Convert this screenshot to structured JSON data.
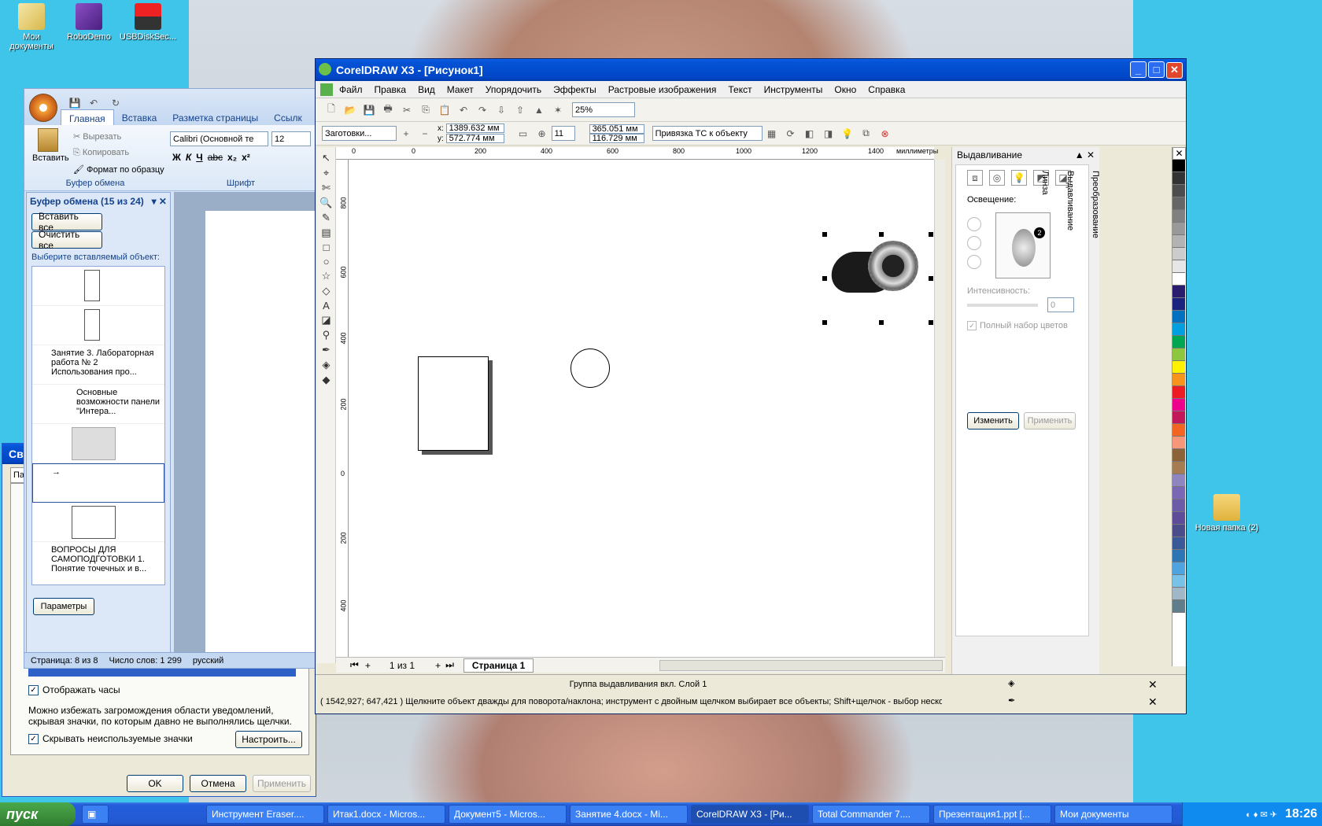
{
  "desktop": {
    "icons_left": [
      {
        "label": "Мои документы",
        "icon": "my-documents-icon"
      },
      {
        "label": "RoboDemo",
        "icon": "robodemo-icon"
      },
      {
        "label": "USBDiskSec...",
        "icon": "usb-disk-icon"
      }
    ],
    "icon_right": {
      "label": "Новая папка (2)",
      "icon": "folder-icon"
    }
  },
  "word": {
    "tabs": [
      "Главная",
      "Вставка",
      "Разметка страницы",
      "Ссылк"
    ],
    "paste_label": "Вставить",
    "cut_label": "Вырезать",
    "copy_label": "Копировать",
    "format_label": "Формат по образцу",
    "group_clipboard": "Буфер обмена",
    "font_name": "Calibri (Основной те",
    "font_size": "12",
    "group_font": "Шрифт",
    "format_buttons": [
      "Ж",
      "К",
      "Ч",
      "abc",
      "x₂",
      "x²"
    ],
    "clipboard_pane": {
      "title": "Буфер обмена (15 из 24)",
      "paste_all": "Вставить все",
      "clear_all": "Очистить все",
      "prompt": "Выберите вставляемый объект:",
      "items": [
        {
          "text": ""
        },
        {
          "text": ""
        },
        {
          "text": "Занятие 3. Лабораторная работа № 2 Использования про..."
        },
        {
          "text": "Основные возможности панели \"Интера..."
        },
        {
          "text": ""
        },
        {
          "text": "→"
        },
        {
          "text": ""
        },
        {
          "text": "ВОПРОСЫ ДЛЯ САМОПОДГОТОВКИ 1. Понятие точечных и в..."
        }
      ],
      "params": "Параметры"
    },
    "status": {
      "page": "Страница: 8 из 8",
      "words": "Число слов: 1 299",
      "lang": "русский"
    }
  },
  "props_dialog": {
    "title": "Сво",
    "tab": "Па",
    "show_clock": "Отображать часы",
    "desc": "Можно избежать загромождения области уведомлений, скрывая значки, по которым давно не выполнялись щелчки.",
    "hide_icons": "Скрывать неиспользуемые значки",
    "customize": "Настроить...",
    "ok": "OK",
    "cancel": "Отмена",
    "apply": "Применить"
  },
  "corel": {
    "title": "CorelDRAW X3 - [Рисунок1]",
    "menu": [
      "Файл",
      "Правка",
      "Вид",
      "Макет",
      "Упорядочить",
      "Эффекты",
      "Растровые изображения",
      "Текст",
      "Инструменты",
      "Окно",
      "Справка"
    ],
    "zoom": "25%",
    "presets": "Заготовки...",
    "x_label": "x:",
    "x_value": "1389.632 мм",
    "y_label": "y:",
    "y_value": "572.774 мм",
    "size_w": "365.051 мм",
    "size_h": "116.729 мм",
    "nudge": "11",
    "snap": "Привязка ТС к объекту",
    "ruler_h_ticks": [
      "0",
      "0",
      "200",
      "400",
      "600",
      "800",
      "1000",
      "1200",
      "1400"
    ],
    "ruler_h_unit": "миллиметры",
    "ruler_v_ticks": [
      "800",
      "600",
      "400",
      "200",
      "0",
      "200",
      "400"
    ],
    "ruler_v_unit": "миллиметры",
    "page_nav": "1 из 1",
    "page_tab": "Страница 1",
    "status_object": "Группа выдавливания вкл. Слой 1",
    "status_hint": "( 1542,927; 647,421 )  Щелкните объект дважды для поворота/наклона; инструмент с двойным щелчком выбирает все объекты; Shift+щелчок - выбор нескол...",
    "docker": {
      "title": "Выдавливание",
      "lighting": "Освещение:",
      "intensity": "Интенсивность:",
      "intensity_value": "0",
      "full_colors": "Полный набор цветов",
      "edit": "Изменить",
      "apply": "Применить",
      "vtabs": [
        "Преобразование",
        "Выдавливание",
        "Линза"
      ],
      "light_number": "2"
    },
    "palette": [
      "#000000",
      "#333333",
      "#4d4d4d",
      "#666666",
      "#808080",
      "#999999",
      "#b3b3b3",
      "#cccccc",
      "#e6e6e6",
      "#ffffff",
      "#2b1d6e",
      "#1a237e",
      "#0070c0",
      "#00a0e0",
      "#00a651",
      "#8dc63f",
      "#fff200",
      "#f7941d",
      "#ed1c24",
      "#ec008c",
      "#c2185b",
      "#f26522",
      "#f7977a",
      "#8c6239",
      "#a67c52",
      "#8f86c0",
      "#7b68b5",
      "#6c5ba7",
      "#5e4c9a",
      "#4b4d8a",
      "#3b5998",
      "#2e75b6",
      "#4fa3e0",
      "#78c2e8",
      "#9fb7c7",
      "#607d8b"
    ]
  },
  "taskbar": {
    "start": "пуск",
    "tasks": [
      "Инструмент Eraser....",
      "Итак1.docx - Micros...",
      "Документ5 - Micros...",
      "Занятие 4.docx - Mi...",
      "CorelDRAW X3 - [Ри...",
      "Total Commander 7....",
      "Презентация1.ppt [...",
      "Мои документы"
    ],
    "active_index": 4,
    "clock": "18:26"
  }
}
